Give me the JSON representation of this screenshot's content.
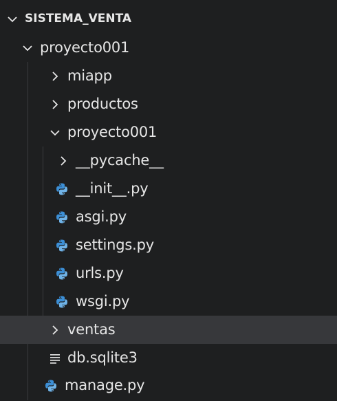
{
  "explorer": {
    "root": {
      "label": "SISTEMA_VENTA",
      "expanded": true
    },
    "items": [
      {
        "label": "proyecto001",
        "type": "folder",
        "expanded": true,
        "depth": 1
      },
      {
        "label": "miapp",
        "type": "folder",
        "expanded": false,
        "depth": 2
      },
      {
        "label": "productos",
        "type": "folder",
        "expanded": false,
        "depth": 2
      },
      {
        "label": "proyecto001",
        "type": "folder",
        "expanded": true,
        "depth": 2
      },
      {
        "label": "__pycache__",
        "type": "folder",
        "expanded": false,
        "depth": 3
      },
      {
        "label": "__init__.py",
        "type": "python-file",
        "depth": 3
      },
      {
        "label": "asgi.py",
        "type": "python-file",
        "depth": 3
      },
      {
        "label": "settings.py",
        "type": "python-file",
        "depth": 3
      },
      {
        "label": "urls.py",
        "type": "python-file",
        "depth": 3
      },
      {
        "label": "wsgi.py",
        "type": "python-file",
        "depth": 3
      },
      {
        "label": "ventas",
        "type": "folder",
        "expanded": false,
        "depth": 2,
        "selected": true
      },
      {
        "label": "db.sqlite3",
        "type": "database-file",
        "depth": 2
      },
      {
        "label": "manage.py",
        "type": "python-file",
        "depth": 1
      }
    ]
  },
  "colors": {
    "background": "#1e1f20",
    "selected_row": "#37383b",
    "text": "#e6e6e6",
    "python_icon": "#3c8fd6",
    "python_icon_light": "#6fb3e8"
  },
  "icons": {
    "expanded": "chevron-down-icon",
    "collapsed": "chevron-right-icon",
    "python": "python-icon",
    "database": "lines-icon"
  }
}
